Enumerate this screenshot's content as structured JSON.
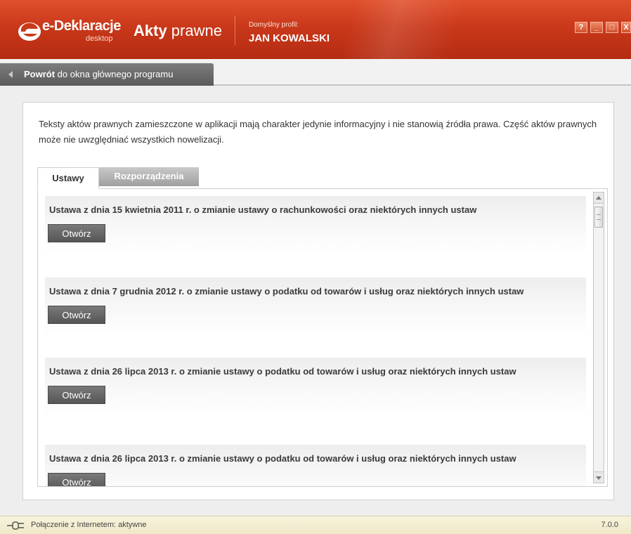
{
  "app": {
    "brand": "e-Deklaracje",
    "brand_sub": "desktop",
    "module_bold": "Akty",
    "module_rest": " prawne",
    "profile_label": "Domyślny profil:",
    "profile_name": "JAN KOWALSKI",
    "window_buttons": [
      "?",
      "_",
      "□",
      "X"
    ]
  },
  "back": {
    "bold": "Powrót",
    "rest": " do okna głównego programu"
  },
  "info_text": "Teksty aktów prawnych zamieszczone w aplikacji mają charakter jedynie informacyjny i nie stanowią źródła prawa. Część aktów prawnych może nie uwzględniać wszystkich nowelizacji.",
  "tabs": [
    {
      "label": "Ustawy",
      "active": true
    },
    {
      "label": "Rozporządzenia",
      "active": false
    }
  ],
  "items": [
    {
      "title": "Ustawa z dnia 15 kwietnia 2011 r. o zmianie ustawy o rachunkowości oraz niektórych innych ustaw",
      "button": "Otwórz"
    },
    {
      "title": "Ustawa z dnia 7 grudnia 2012 r. o zmianie ustawy o podatku od towarów i usług oraz niektórych innych ustaw",
      "button": "Otwórz"
    },
    {
      "title": "Ustawa z dnia 26 lipca 2013 r. o zmianie ustawy o podatku od towarów i usług oraz niektórych innych ustaw",
      "button": "Otwórz"
    },
    {
      "title": "Ustawa z dnia 26 lipca 2013 r. o zmianie ustawy o podatku od towarów i usług oraz niektórych innych ustaw",
      "button": "Otwórz"
    }
  ],
  "status": {
    "connection": "Połączenie z Internetem: aktywne",
    "version": "7.0.0"
  },
  "icons": {
    "logo": "e-deklaracje-logo-icon",
    "back_arrow": "back-arrow-icon",
    "plug": "plug-icon"
  },
  "colors": {
    "titlebar": "#c9381a",
    "tab_inactive": "#b0b0b0",
    "button": "#666666"
  }
}
